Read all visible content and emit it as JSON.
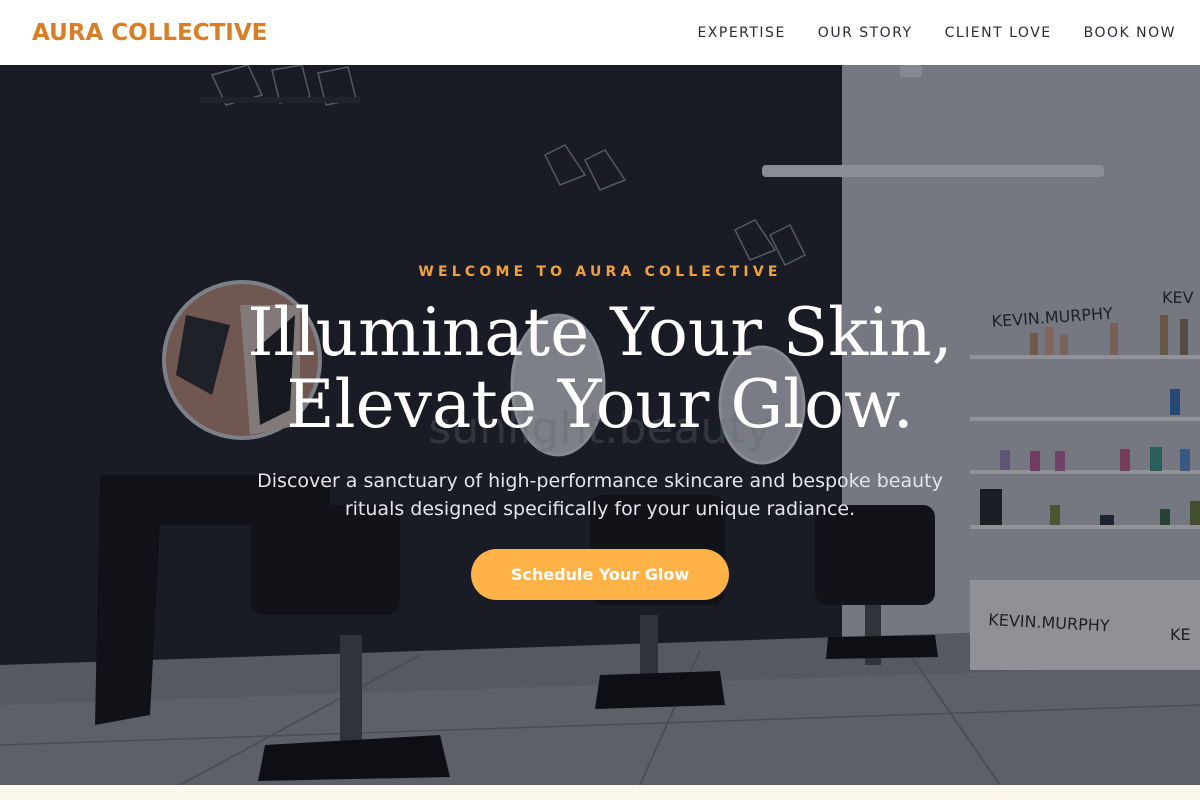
{
  "header": {
    "brand": "AURA COLLECTIVE",
    "nav": [
      {
        "label": "EXPERTISE"
      },
      {
        "label": "OUR STORY"
      },
      {
        "label": "CLIENT LOVE"
      },
      {
        "label": "BOOK NOW"
      }
    ]
  },
  "hero": {
    "eyebrow": "WELCOME TO AURA COLLECTIVE",
    "headline_line1": "Illuminate Your Skin,",
    "headline_line2": "Elevate Your Glow.",
    "subtitle": "Discover a sanctuary of high-performance skincare and bespoke beauty rituals designed specifically for your unique radiance.",
    "cta_label": "Schedule Your Glow",
    "photo_signage": {
      "shelf_brand_top": "KEVIN.MURPHY",
      "shelf_brand_top_right": "KEV",
      "counter_brand": "KEVIN.MURPHY",
      "counter_brand_right": "KE"
    }
  },
  "colors": {
    "brand": "#d97e26",
    "eyebrow": "#f2a23a",
    "cta_bg": "#ffb347",
    "nav_text": "#2c2c34",
    "strip": "#fdf8ee"
  },
  "icons": [
    "hanging-planter-icon",
    "salon-chair-icon",
    "round-mirror-icon"
  ]
}
